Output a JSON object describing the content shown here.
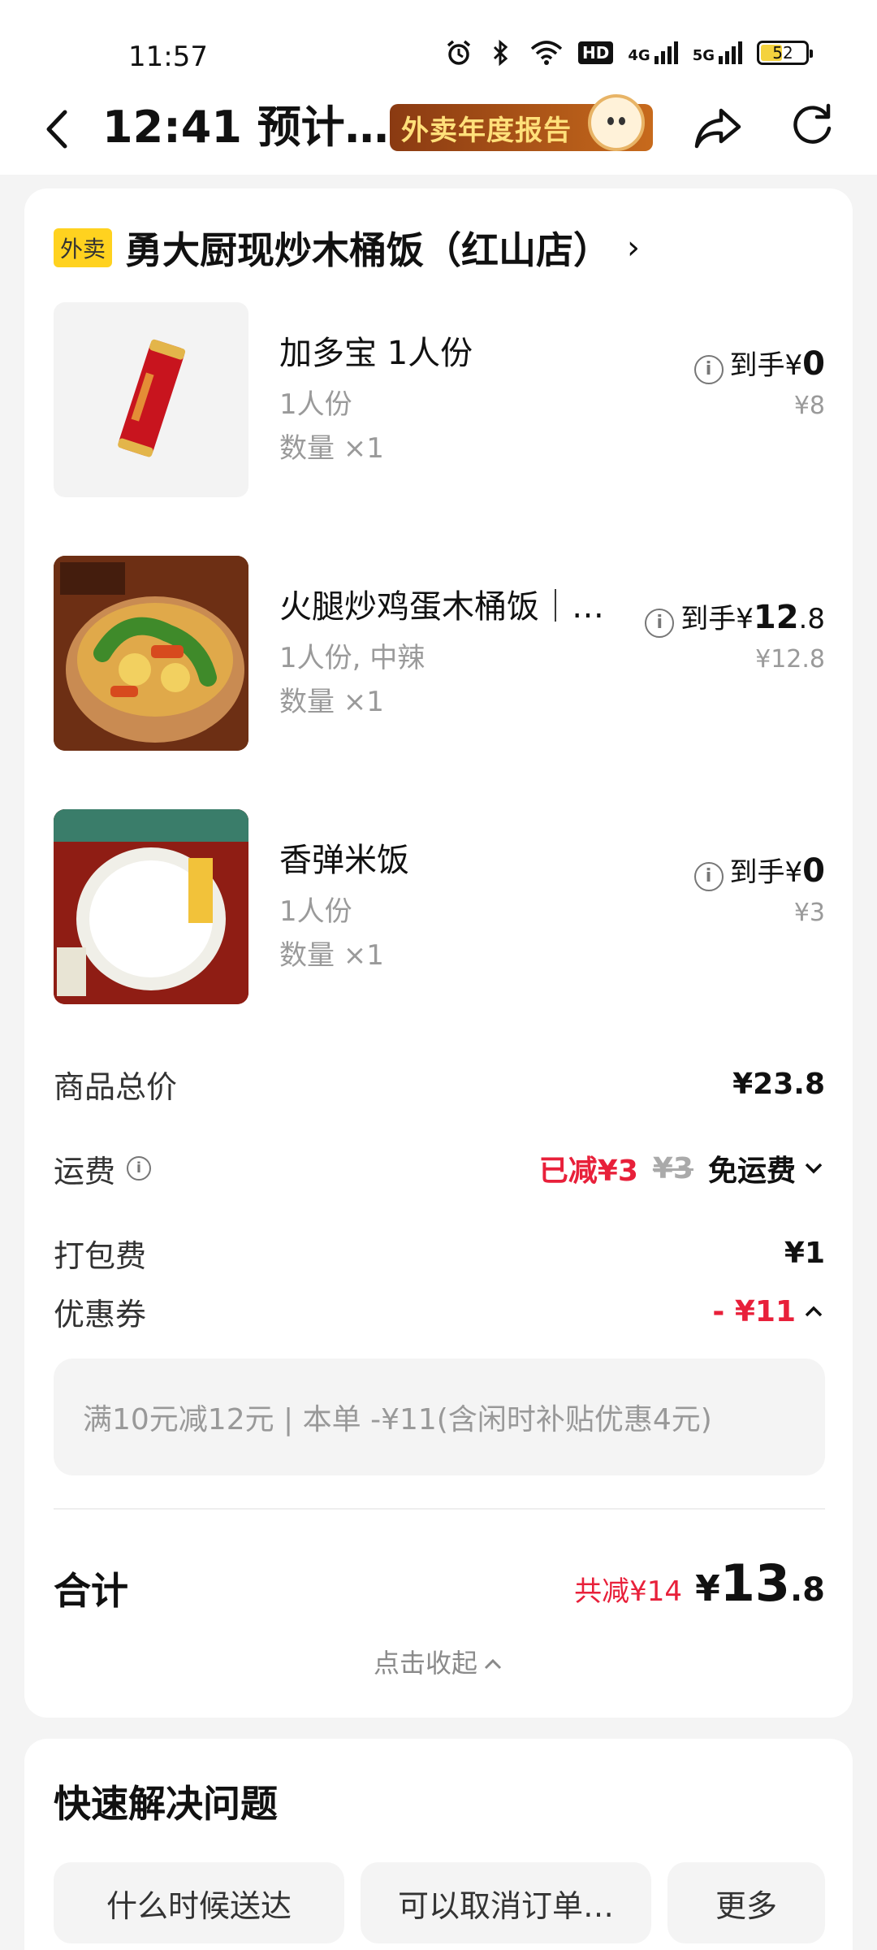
{
  "status_bar": {
    "time": "11:57",
    "signal_4g": "4G",
    "signal_5g": "5G",
    "hd": "HD",
    "battery": "52",
    "battery_level": 0.52
  },
  "header": {
    "title": "12:41 预计…",
    "banner_text": "外卖年度报告"
  },
  "shop": {
    "tag": "外卖",
    "name": "勇大厨现炒木桶饭（红山店）",
    "chevron": "›"
  },
  "items": [
    {
      "name": "加多宝 1人份",
      "spec": "1人份",
      "qty": "数量 ×1",
      "price_prefix": "到手¥",
      "price": "0",
      "price_decimal": "",
      "orig": "¥8"
    },
    {
      "name": "火腿炒鸡蛋木桶饭｜…",
      "spec": "1人份, 中辣",
      "qty": "数量 ×1",
      "price_prefix": "到手¥",
      "price": "12",
      "price_decimal": ".8",
      "orig": "¥12.8"
    },
    {
      "name": "香弹米饭",
      "spec": "1人份",
      "qty": "数量 ×1",
      "price_prefix": "到手¥",
      "price": "0",
      "price_decimal": "",
      "orig": "¥3"
    }
  ],
  "summary": {
    "goods_total_label": "商品总价",
    "goods_total": "¥23.8",
    "delivery_label": "运费",
    "delivery_reduced": "已减¥3",
    "delivery_orig": "¥3",
    "delivery_value": "免运费",
    "packing_label": "打包费",
    "packing": "¥1",
    "coupon_label": "优惠券",
    "coupon_value": "- ¥11",
    "coupon_detail": "满10元减12元 | 本单 -¥11(含闲时补贴优惠4元)"
  },
  "total": {
    "label": "合计",
    "saved": "共减¥14",
    "yen": "¥",
    "amount": "13",
    "decimal": ".8",
    "collapse": "点击收起"
  },
  "quick": {
    "title": "快速解决问题",
    "buttons": [
      "什么时候送达",
      "可以取消订单…",
      "更多"
    ]
  },
  "colors": {
    "accent_red": "#e8203a",
    "tag_yellow": "#ffd21f"
  }
}
